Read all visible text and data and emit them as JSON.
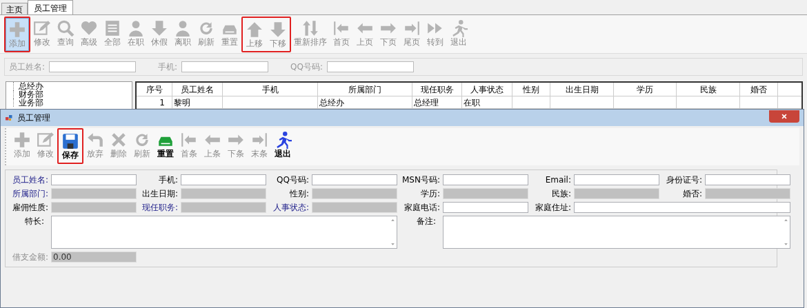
{
  "tabs": [
    {
      "label": "主页",
      "selected": false
    },
    {
      "label": "员工管理",
      "selected": true
    }
  ],
  "toolbar": [
    {
      "label": "添加",
      "disabled": true,
      "selected": true,
      "annotated": true
    },
    {
      "label": "修改",
      "disabled": true,
      "selected": false,
      "annotated": false
    },
    {
      "label": "查询",
      "disabled": true,
      "selected": false,
      "annotated": false
    },
    {
      "label": "高级",
      "disabled": true,
      "selected": false,
      "annotated": false
    },
    {
      "label": "全部",
      "disabled": true,
      "selected": false,
      "annotated": false
    },
    {
      "label": "在职",
      "disabled": true,
      "selected": false,
      "annotated": false
    },
    {
      "label": "休假",
      "disabled": true,
      "selected": false,
      "annotated": false
    },
    {
      "label": "离职",
      "disabled": true,
      "selected": false,
      "annotated": false
    },
    {
      "label": "刷新",
      "disabled": true,
      "selected": false,
      "annotated": false
    },
    {
      "label": "重置",
      "disabled": true,
      "selected": false,
      "annotated": false
    },
    {
      "label": "上移",
      "disabled": true,
      "selected": false,
      "annotated": true
    },
    {
      "label": "下移",
      "disabled": true,
      "selected": false,
      "annotated": true
    },
    {
      "label": "重新排序",
      "disabled": true,
      "selected": false,
      "annotated": false
    },
    {
      "label": "首页",
      "disabled": true,
      "selected": false,
      "annotated": false
    },
    {
      "label": "上页",
      "disabled": true,
      "selected": false,
      "annotated": false
    },
    {
      "label": "下页",
      "disabled": true,
      "selected": false,
      "annotated": false
    },
    {
      "label": "尾页",
      "disabled": true,
      "selected": false,
      "annotated": false
    },
    {
      "label": "转到",
      "disabled": true,
      "selected": false,
      "annotated": false
    },
    {
      "label": "退出",
      "disabled": true,
      "selected": false,
      "annotated": false
    }
  ],
  "search": [
    {
      "label": "员工姓名:"
    },
    {
      "label": "手机:"
    },
    {
      "label": "QQ号码:"
    }
  ],
  "tree": {
    "items": [
      {
        "label": "总经办"
      },
      {
        "label": "财务部"
      },
      {
        "label": "业务部"
      }
    ]
  },
  "table": {
    "columns": [
      "序号",
      "员工姓名",
      "手机",
      "所属部门",
      "现任职务",
      "人事状态",
      "性别",
      "出生日期",
      "学历",
      "民族",
      "婚否"
    ],
    "rows": [
      [
        "1",
        "黎明",
        "",
        "总经办",
        "总经理",
        "在职",
        "",
        "",
        "",
        "",
        ""
      ]
    ]
  },
  "dialog": {
    "title": "员工管理",
    "toolbar": [
      {
        "label": "添加",
        "disabled": true,
        "annotated": false
      },
      {
        "label": "修改",
        "disabled": true,
        "annotated": false
      },
      {
        "label": "保存",
        "disabled": false,
        "annotated": true
      },
      {
        "label": "放弃",
        "disabled": true,
        "annotated": false
      },
      {
        "label": "删除",
        "disabled": true,
        "annotated": false
      },
      {
        "label": "刷新",
        "disabled": true,
        "annotated": false
      },
      {
        "label": "重置",
        "disabled": false,
        "annotated": false
      },
      {
        "label": "首条",
        "disabled": true,
        "annotated": false
      },
      {
        "label": "上条",
        "disabled": true,
        "annotated": false
      },
      {
        "label": "下条",
        "disabled": true,
        "annotated": false
      },
      {
        "label": "末条",
        "disabled": true,
        "annotated": false
      },
      {
        "label": "退出",
        "disabled": false,
        "annotated": false
      }
    ],
    "fields": [
      {
        "label": "员工姓名:",
        "kind": "input",
        "required": true
      },
      {
        "label": "手机:",
        "kind": "input",
        "required": false
      },
      {
        "label": "QQ号码:",
        "kind": "input",
        "required": false
      },
      {
        "label": "MSN号码:",
        "kind": "input",
        "required": false
      },
      {
        "label": "Email:",
        "kind": "input",
        "required": false
      },
      {
        "label": "身份证号:",
        "kind": "input",
        "required": false
      },
      {
        "label": "所属部门:",
        "kind": "readonly",
        "required": true
      },
      {
        "label": "出生日期:",
        "kind": "readonly",
        "required": false
      },
      {
        "label": "性别:",
        "kind": "readonly",
        "required": false
      },
      {
        "label": "学历:",
        "kind": "readonly",
        "required": false
      },
      {
        "label": "民族:",
        "kind": "readonly",
        "required": false
      },
      {
        "label": "婚否:",
        "kind": "readonly",
        "required": false
      },
      {
        "label": "雇佣性质:",
        "kind": "readonly",
        "required": false
      },
      {
        "label": "现任职务:",
        "kind": "readonly",
        "required": true
      },
      {
        "label": "人事状态:",
        "kind": "readonly",
        "required": true
      },
      {
        "label": "家庭电话:",
        "kind": "input",
        "required": false
      },
      {
        "label": "家庭住址:",
        "kind": "wide",
        "required": false
      },
      {
        "label": "特长:",
        "kind": "textarea",
        "required": false
      },
      {
        "label": "备注:",
        "kind": "textarea",
        "required": false
      },
      {
        "label": "借支金额:",
        "kind": "readonly",
        "disabled": true,
        "value": "0.00"
      }
    ]
  }
}
